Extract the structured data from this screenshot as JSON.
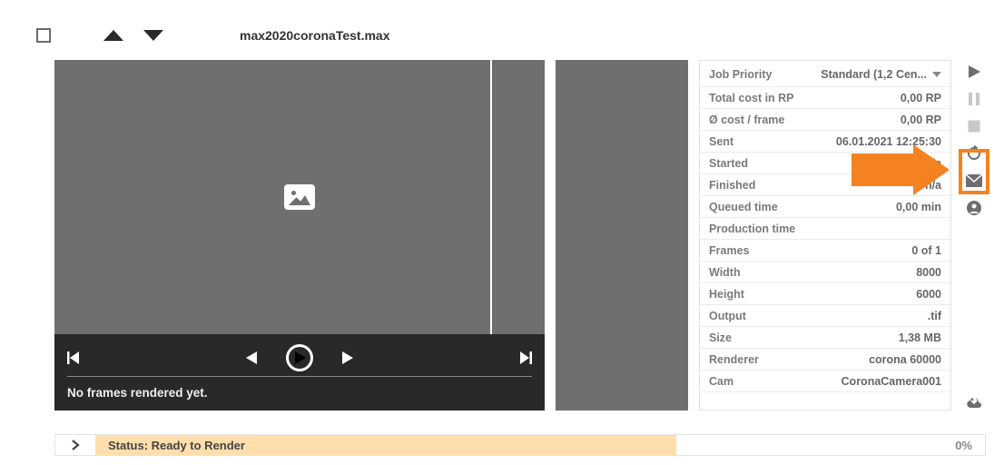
{
  "header": {
    "filename": "max2020coronaTest.max"
  },
  "preview": {
    "no_frames_text": "No frames rendered yet."
  },
  "info": {
    "priority_label": "Job Priority",
    "priority_value": "Standard (1,2 Cen...",
    "rows": [
      {
        "k": "Total cost in RP",
        "v": "0,00 RP"
      },
      {
        "k": "Ø cost / frame",
        "v": "0,00 RP"
      },
      {
        "k": "Sent",
        "v": "06.01.2021 12:25:30"
      },
      {
        "k": "Started",
        "v": "n/a"
      },
      {
        "k": "Finished",
        "v": "n/a"
      },
      {
        "k": "Queued time",
        "v": "0,00 min"
      },
      {
        "k": "Production time",
        "v": ""
      },
      {
        "k": "Frames",
        "v": "0 of 1"
      },
      {
        "k": "Width",
        "v": "8000"
      },
      {
        "k": "Height",
        "v": "6000"
      },
      {
        "k": "Output",
        "v": ".tif"
      },
      {
        "k": "Size",
        "v": "1,38 MB"
      },
      {
        "k": "Renderer",
        "v": "corona 60000"
      },
      {
        "k": "Cam",
        "v": "CoronaCamera001"
      }
    ]
  },
  "status": {
    "label": "Status: Ready to Render",
    "percent": "0%"
  }
}
